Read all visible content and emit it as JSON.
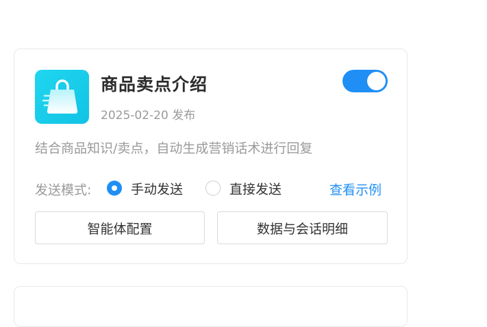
{
  "card": {
    "title": "商品卖点介绍",
    "publish_date": "2025-02-20 发布",
    "description": "结合商品知识/卖点，自动生成营销话术进行回复",
    "toggle_on": true,
    "icon": "shopping-bag-icon",
    "send_mode": {
      "label": "发送模式:",
      "options": [
        {
          "label": "手动发送",
          "checked": true
        },
        {
          "label": "直接发送",
          "checked": false
        }
      ]
    },
    "view_example_link": "查看示例",
    "buttons": {
      "agent_config": "智能体配置",
      "data_details": "数据与会话明细"
    }
  },
  "colors": {
    "accent": "#1f8ff5",
    "icon_bg": "#14c8e8",
    "muted_text": "#9a9a9a"
  }
}
